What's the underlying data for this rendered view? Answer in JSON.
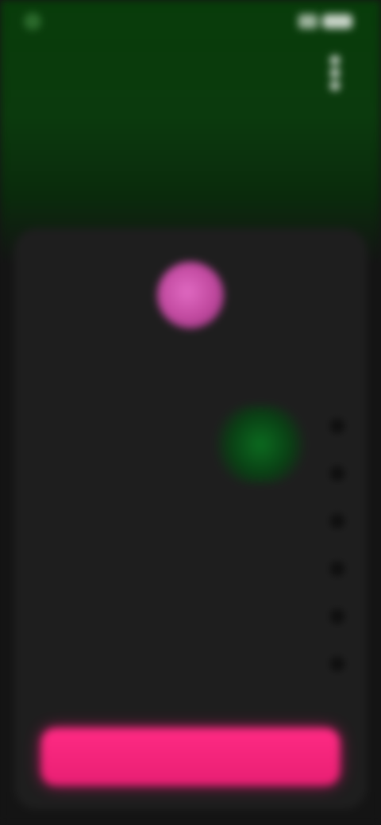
{
  "status_bar": {
    "time": "",
    "battery": ""
  },
  "header": {
    "title": ""
  },
  "subheader": {
    "left_text": "",
    "right_text": ""
  },
  "profile": {
    "name": ""
  },
  "list": [
    {
      "label": ""
    },
    {
      "label": ""
    },
    {
      "label": ""
    },
    {
      "label": ""
    },
    {
      "label": ""
    },
    {
      "label": ""
    }
  ],
  "cta": {
    "label": ""
  },
  "colors": {
    "accent_pink": "#e81f73",
    "header_green": "#083c0a",
    "card_bg": "#1e1e1e"
  },
  "icons": {
    "menu": "more-vertical-icon",
    "status_dot": "status-dot",
    "signal": "signal-icon",
    "battery": "battery-icon",
    "check": "circle-icon"
  }
}
